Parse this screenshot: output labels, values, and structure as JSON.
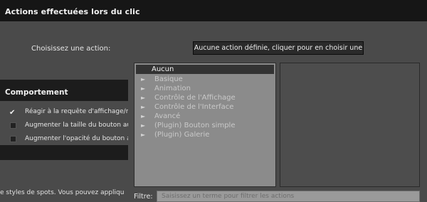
{
  "title": "Actions effectuées lors du clic",
  "choose_label": "Choisissez une action:",
  "action_button_label": "Aucune action définie, cliquer pour en choisir une",
  "behavior_header": "Comportement",
  "options": [
    {
      "label": "Réagir à la requête d'affichage/r",
      "checked": true
    },
    {
      "label": "Augmenter la taille du bouton au",
      "checked": false
    },
    {
      "label": "Augmenter l'opacité du bouton a",
      "checked": false
    }
  ],
  "footer_text": "e styles de spots. Vous pouvez appliqu",
  "action_list": {
    "selected": "Aucun",
    "items": [
      "Basique",
      "Animation",
      "Contrôle de l'Affichage",
      "Contrôle de l'Interface",
      "Avancé",
      "(Plugin) Bouton simple",
      "(Plugin) Galerie"
    ]
  },
  "filter": {
    "label": "Filtre:",
    "placeholder": "Saisissez un terme pour filtrer les actions"
  }
}
